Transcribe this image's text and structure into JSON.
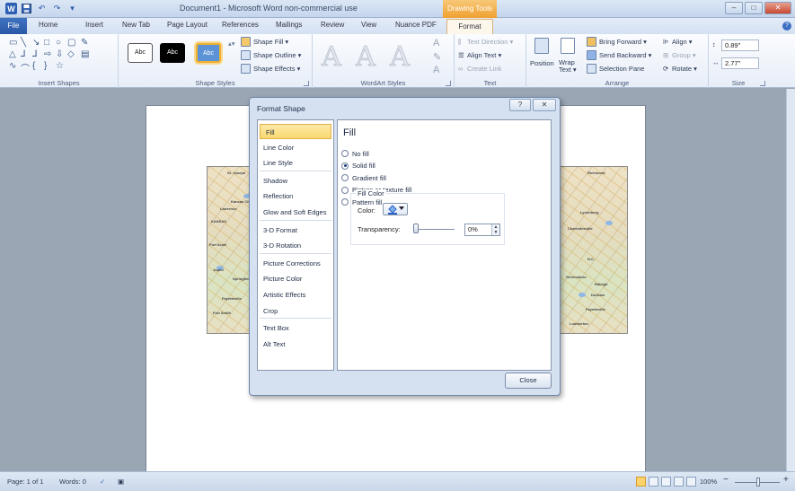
{
  "title_bar": {
    "document_title": "Document1 - Microsoft Word non-commercial use",
    "contextual_group": "Drawing Tools",
    "word_logo": "W",
    "undo_symbol": "↶",
    "redo_symbol": "↷",
    "minimize": "–",
    "restore": "□",
    "close": "✕"
  },
  "tabs": {
    "file": "File",
    "home": "Home",
    "insert": "Insert",
    "new_tab": "New Tab",
    "page_layout": "Page Layout",
    "references": "References",
    "mailings": "Mailings",
    "review": "Review",
    "view": "View",
    "nuance_pdf": "Nuance PDF",
    "format": "Format"
  },
  "ribbon": {
    "insert_shapes": {
      "label": "Insert Shapes"
    },
    "shape_styles": {
      "label": "Shape Styles",
      "style_text": "Abc",
      "shape_fill": "Shape Fill ▾",
      "shape_outline": "Shape Outline ▾",
      "shape_effects": "Shape Effects ▾"
    },
    "wordart_styles": {
      "label": "WordArt Styles",
      "letter": "A"
    },
    "text": {
      "label": "Text",
      "text_direction": "Text Direction ▾",
      "align_text": "Align Text ▾",
      "create_link": "Create Link"
    },
    "arrange": {
      "label": "Arrange",
      "position": "Position",
      "wrap_text": "Wrap Text ▾",
      "bring_forward": "Bring Forward ▾",
      "send_backward": "Send Backward ▾",
      "selection_pane": "Selection Pane",
      "align": "Align ▾",
      "group": "Group ▾",
      "rotate": "Rotate ▾"
    },
    "size": {
      "label": "Size",
      "height": "0.89\"",
      "width": "2.77\""
    }
  },
  "map_labels": {
    "left": [
      "St. Joseph",
      "Kansas City",
      "Lawrence",
      "KANSAS",
      "Fort Scott",
      "Joplin",
      "Springfield",
      "Fayetteville",
      "Fort Smith"
    ],
    "right": [
      "Richmond",
      "Lynchburg",
      "Charlottesville",
      "N.C.",
      "Raleigh",
      "Greensboro",
      "Durham",
      "Fayetteville",
      "Lumberton"
    ]
  },
  "dialog": {
    "title": "Format Shape",
    "help": "?",
    "close_x": "✕",
    "categories": [
      "Fill",
      "Line Color",
      "Line Style",
      "Shadow",
      "Reflection",
      "Glow and Soft Edges",
      "3-D Format",
      "3-D Rotation",
      "Picture Corrections",
      "Picture Color",
      "Artistic Effects",
      "Crop",
      "Text Box",
      "Alt Text"
    ],
    "selected_category": "Fill",
    "fill": {
      "heading": "Fill",
      "options": [
        "No fill",
        "Solid fill",
        "Gradient fill",
        "Picture or texture fill",
        "Pattern fill"
      ],
      "selected_option": "Solid fill",
      "fill_color_group": "Fill Color",
      "color_label": "Color:",
      "color_icon": "paint-bucket-icon",
      "transparency_label": "Transparency:",
      "transparency_value": "0%",
      "transparency_fraction": 0
    },
    "close_button": "Close"
  },
  "status_bar": {
    "page": "Page: 1 of 1",
    "words": "Words: 0",
    "zoom": "100%",
    "zoom_out": "−",
    "zoom_in": "+"
  },
  "colors": {
    "selected_category_bg": "#f9d86e",
    "file_tab": "#2a58a5",
    "contextual_tab": "#f0a030",
    "document_background": "#9aa6b4"
  }
}
